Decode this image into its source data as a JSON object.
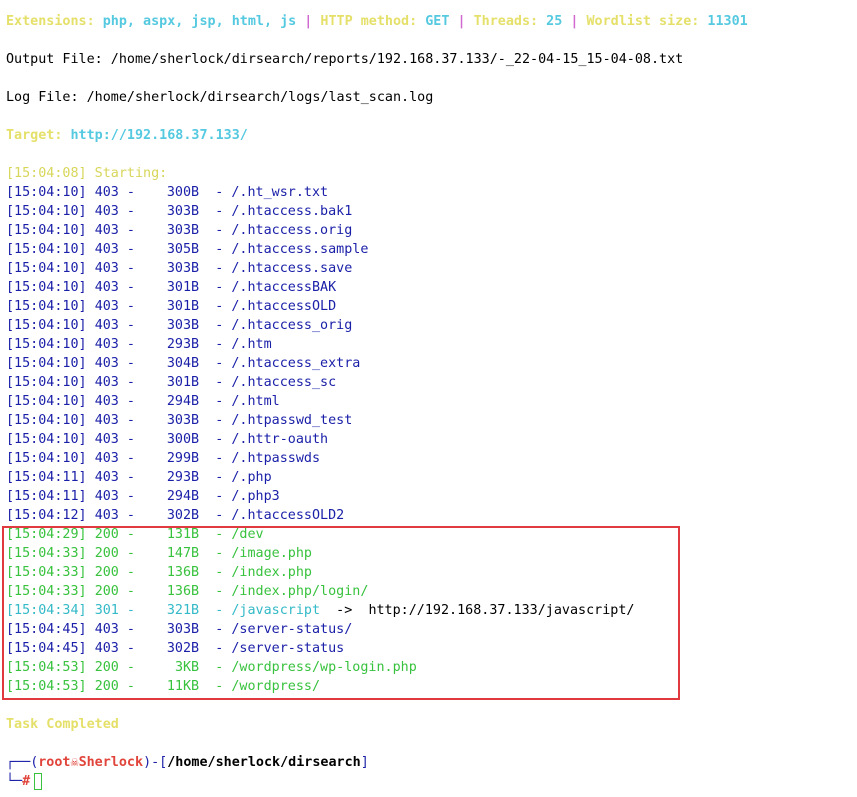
{
  "header": {
    "ext_label": "Extensions:",
    "ext_value": "php, aspx, jsp, html, js",
    "sep": "|",
    "method_label": "HTTP method:",
    "method_value": "GET",
    "threads_label": "Threads:",
    "threads_value": "25",
    "wordlist_label": "Wordlist size:",
    "wordlist_value": "11301"
  },
  "output_file": "Output File: /home/sherlock/dirsearch/reports/192.168.37.133/-_22-04-15_15-04-08.txt",
  "log_file": "Log File: /home/sherlock/dirsearch/logs/last_scan.log",
  "target_label": "Target:",
  "target_value": "http://192.168.37.133/",
  "starting": "[15:04:08] Starting:",
  "results": [
    {
      "time": "[15:04:10]",
      "code": "403",
      "size": "300B",
      "path": "/.ht_wsr.txt"
    },
    {
      "time": "[15:04:10]",
      "code": "403",
      "size": "303B",
      "path": "/.htaccess.bak1"
    },
    {
      "time": "[15:04:10]",
      "code": "403",
      "size": "303B",
      "path": "/.htaccess.orig"
    },
    {
      "time": "[15:04:10]",
      "code": "403",
      "size": "305B",
      "path": "/.htaccess.sample"
    },
    {
      "time": "[15:04:10]",
      "code": "403",
      "size": "303B",
      "path": "/.htaccess.save"
    },
    {
      "time": "[15:04:10]",
      "code": "403",
      "size": "301B",
      "path": "/.htaccessBAK"
    },
    {
      "time": "[15:04:10]",
      "code": "403",
      "size": "301B",
      "path": "/.htaccessOLD"
    },
    {
      "time": "[15:04:10]",
      "code": "403",
      "size": "303B",
      "path": "/.htaccess_orig"
    },
    {
      "time": "[15:04:10]",
      "code": "403",
      "size": "293B",
      "path": "/.htm"
    },
    {
      "time": "[15:04:10]",
      "code": "403",
      "size": "304B",
      "path": "/.htaccess_extra"
    },
    {
      "time": "[15:04:10]",
      "code": "403",
      "size": "301B",
      "path": "/.htaccess_sc"
    },
    {
      "time": "[15:04:10]",
      "code": "403",
      "size": "294B",
      "path": "/.html"
    },
    {
      "time": "[15:04:10]",
      "code": "403",
      "size": "303B",
      "path": "/.htpasswd_test"
    },
    {
      "time": "[15:04:10]",
      "code": "403",
      "size": "300B",
      "path": "/.httr-oauth"
    },
    {
      "time": "[15:04:10]",
      "code": "403",
      "size": "299B",
      "path": "/.htpasswds"
    },
    {
      "time": "[15:04:11]",
      "code": "403",
      "size": "293B",
      "path": "/.php"
    },
    {
      "time": "[15:04:11]",
      "code": "403",
      "size": "294B",
      "path": "/.php3"
    },
    {
      "time": "[15:04:12]",
      "code": "403",
      "size": "302B",
      "path": "/.htaccessOLD2"
    },
    {
      "time": "[15:04:29]",
      "code": "200",
      "size": "131B",
      "path": "/dev"
    },
    {
      "time": "[15:04:33]",
      "code": "200",
      "size": "147B",
      "path": "/image.php"
    },
    {
      "time": "[15:04:33]",
      "code": "200",
      "size": "136B",
      "path": "/index.php"
    },
    {
      "time": "[15:04:33]",
      "code": "200",
      "size": "136B",
      "path": "/index.php/login/"
    },
    {
      "time": "[15:04:34]",
      "code": "301",
      "size": "321B",
      "path": "/javascript",
      "redirect": "http://192.168.37.133/javascript/"
    },
    {
      "time": "[15:04:45]",
      "code": "403",
      "size": "303B",
      "path": "/server-status/"
    },
    {
      "time": "[15:04:45]",
      "code": "403",
      "size": "302B",
      "path": "/server-status"
    },
    {
      "time": "[15:04:53]",
      "code": "200",
      "size": "3KB",
      "path": "/wordpress/wp-login.php"
    },
    {
      "time": "[15:04:53]",
      "code": "200",
      "size": "11KB",
      "path": "/wordpress/"
    }
  ],
  "task_completed": "Task Completed",
  "prompt": {
    "corner_top": "┌──",
    "open_paren": "(",
    "user": "root",
    "skull": "☠",
    "host": "Sherlock",
    "close_paren": ")-[",
    "cwd": "/home/sherlock/dirsearch",
    "close_bracket": "]",
    "corner_bottom": "└─",
    "hash": "#"
  },
  "colors": {
    "code_403": "#1a1fa8",
    "code_200": "#38c23e",
    "code_301": "#33b9c7",
    "highlight_border": "#e03a3e"
  }
}
